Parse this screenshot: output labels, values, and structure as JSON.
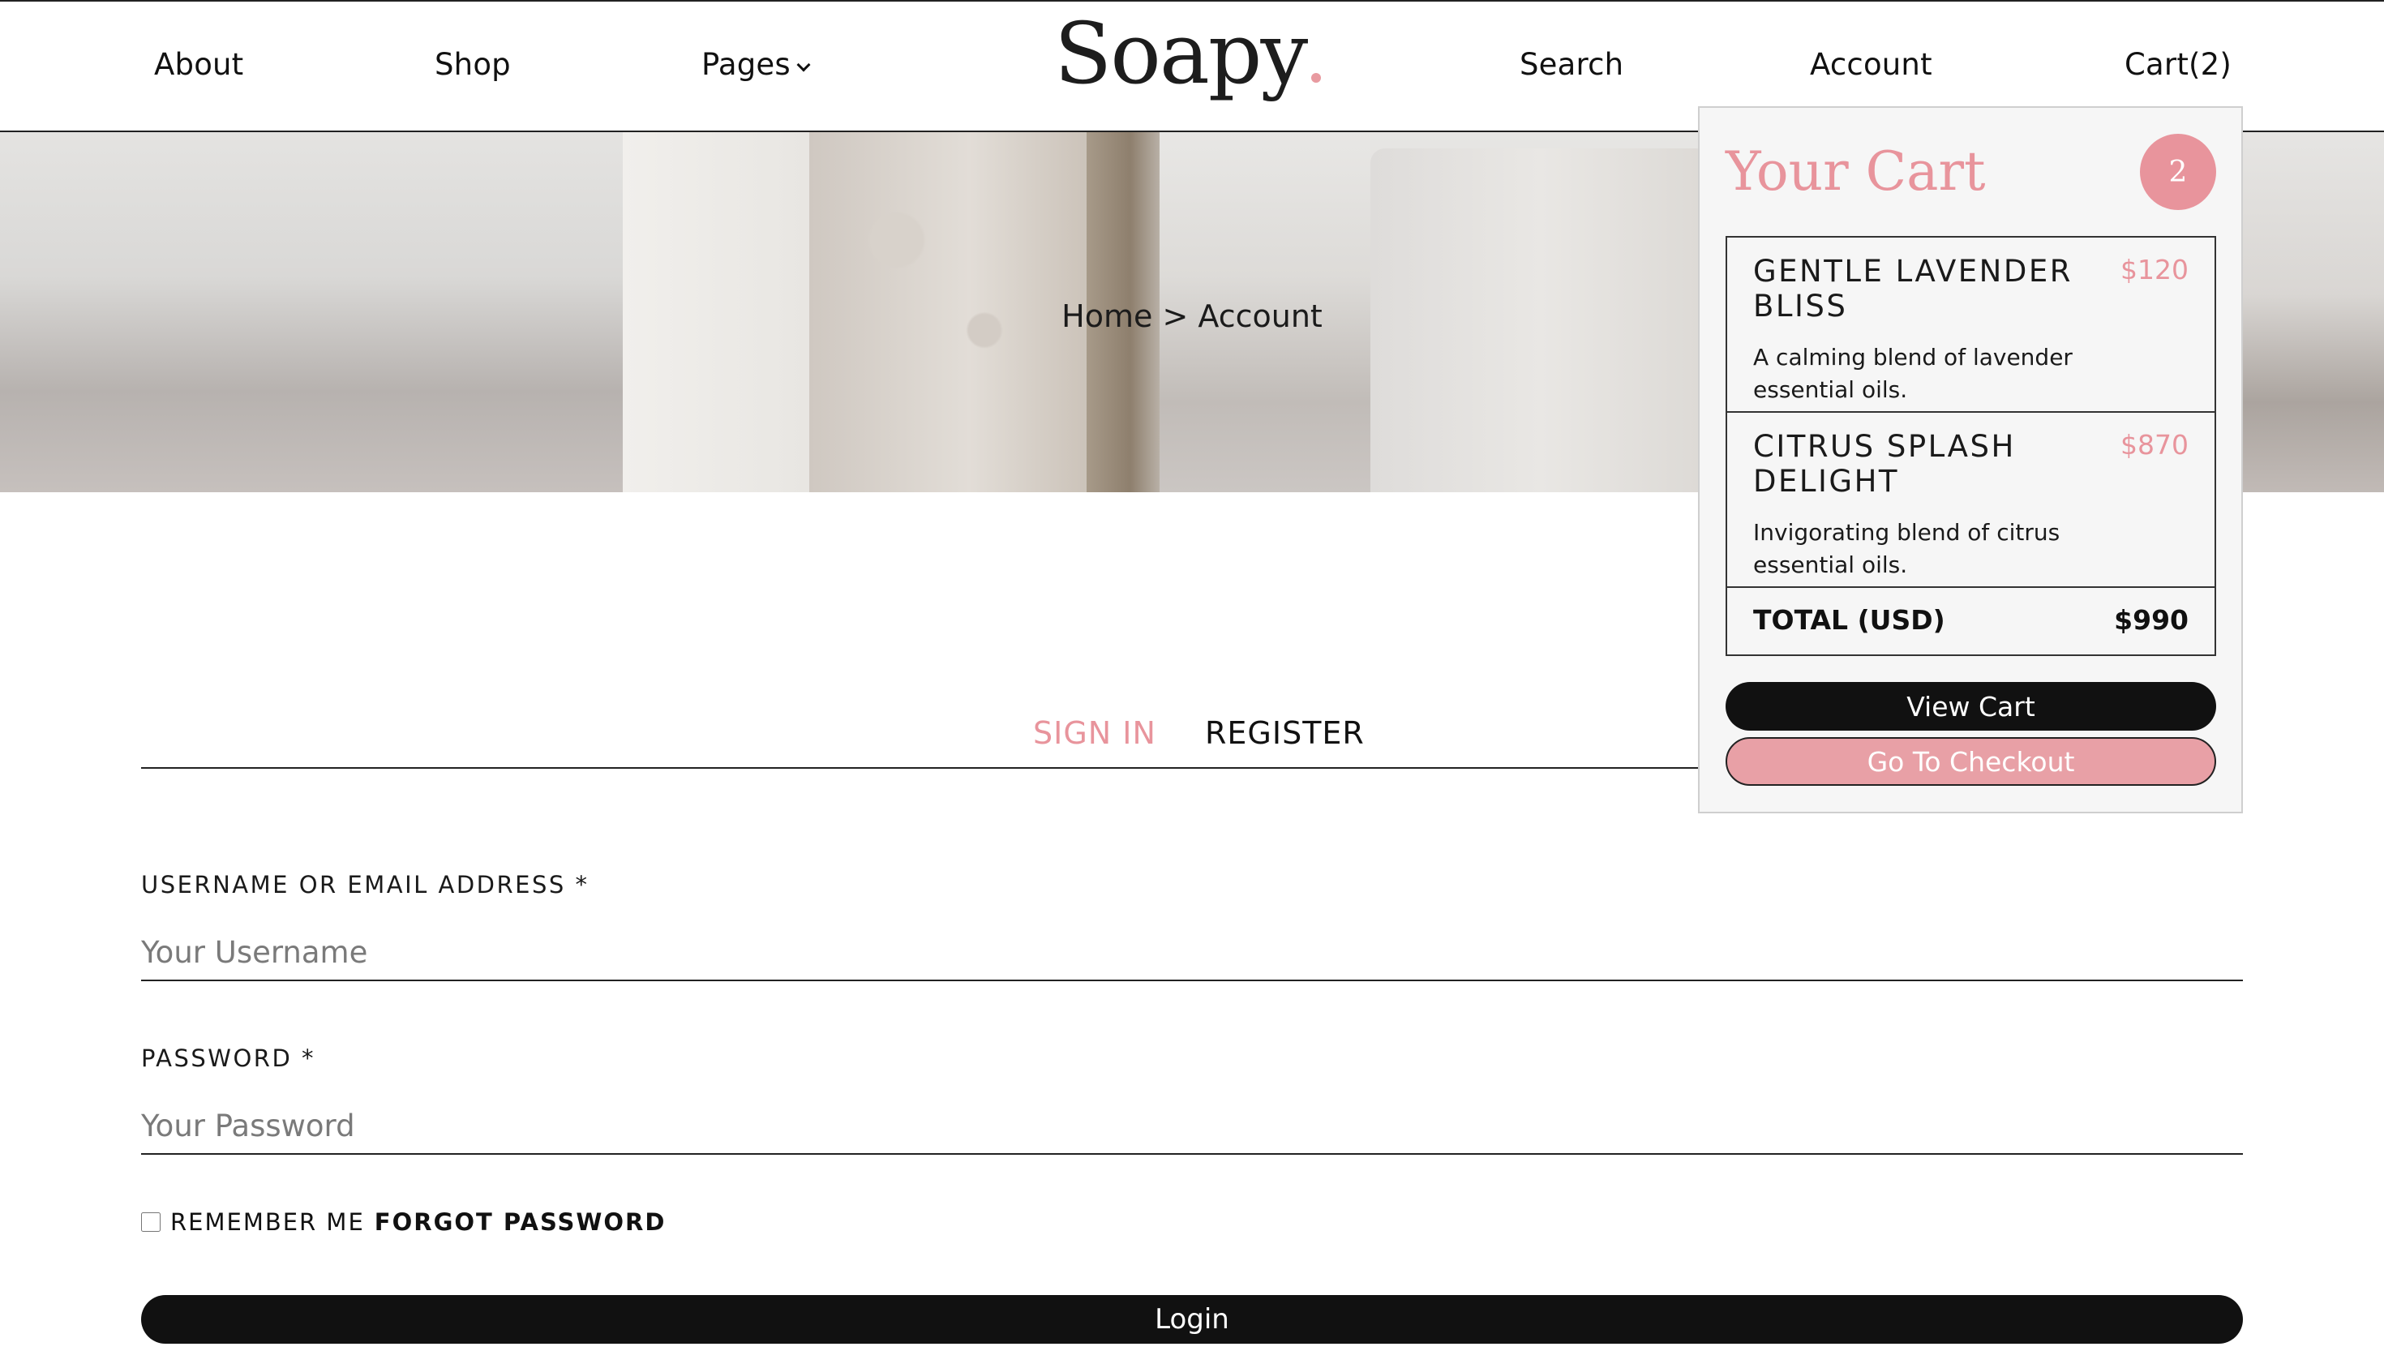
{
  "nav": {
    "about": "About",
    "shop": "Shop",
    "pages": "Pages",
    "search": "Search",
    "account": "Account",
    "cart": "Cart(2)"
  },
  "logo": {
    "text": "Soapy"
  },
  "breadcrumb": "Home > Account",
  "tabs": {
    "sign_in": "SIGN IN",
    "register": "REGISTER"
  },
  "form": {
    "username_label": "USERNAME OR EMAIL ADDRESS *",
    "username_placeholder": "Your Username",
    "password_label": "PASSWORD *",
    "password_placeholder": "Your Password",
    "remember_me": "REMEMBER ME",
    "forgot_password": "FORGOT PASSWORD",
    "login": "Login"
  },
  "cart": {
    "title": "Your Cart",
    "count": "2",
    "items": [
      {
        "name": "GENTLE LAVENDER BLISS",
        "price": "$120",
        "description": "A calming blend of lavender essential oils."
      },
      {
        "name": "CITRUS SPLASH DELIGHT",
        "price": "$870",
        "description": "Invigorating blend of citrus essential oils."
      }
    ],
    "total_label": "TOTAL (USD)",
    "total_value": "$990",
    "view_cart": "View Cart",
    "checkout": "Go To Checkout"
  },
  "colors": {
    "accent": "#e8949c",
    "dark": "#111111"
  }
}
